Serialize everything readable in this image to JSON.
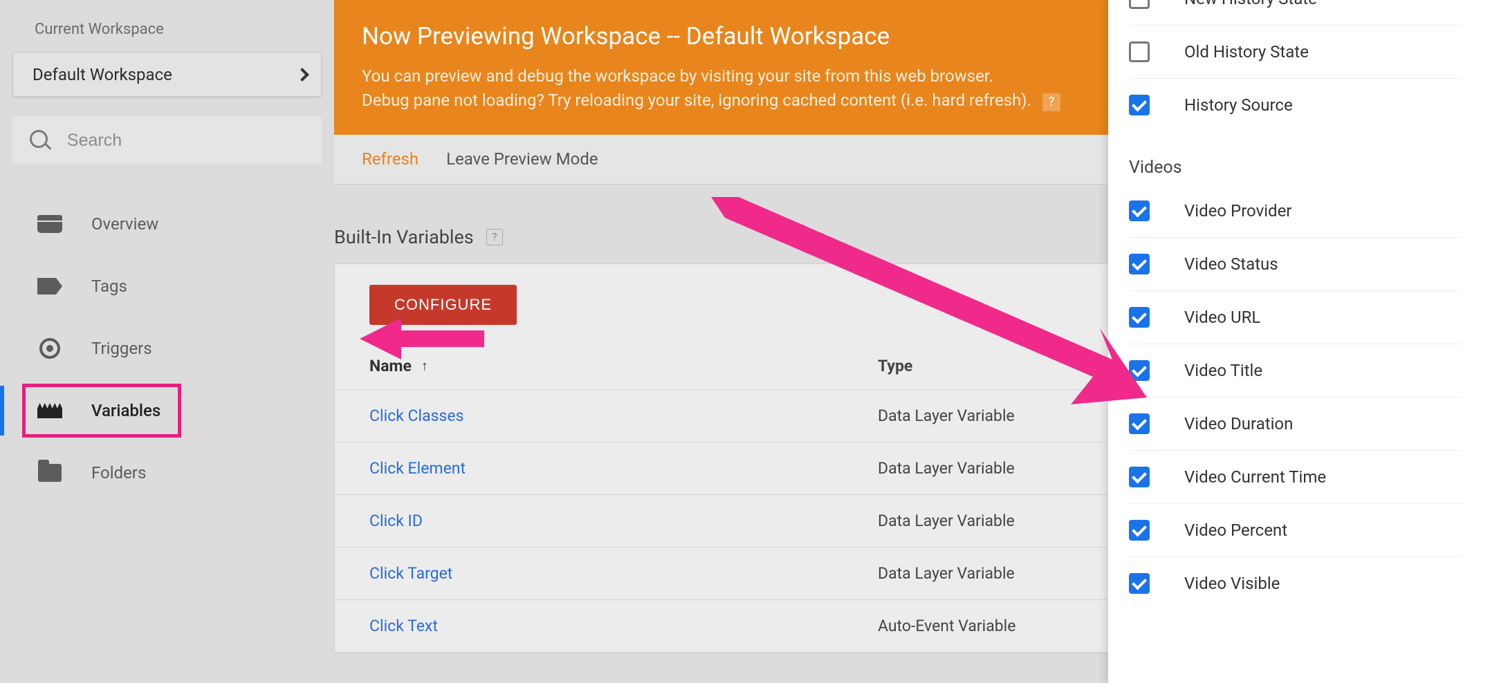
{
  "sidebar": {
    "current_workspace_label": "Current Workspace",
    "workspace_name": "Default Workspace",
    "search_placeholder": "Search",
    "items": [
      {
        "label": "Overview"
      },
      {
        "label": "Tags"
      },
      {
        "label": "Triggers"
      },
      {
        "label": "Variables"
      },
      {
        "label": "Folders"
      }
    ],
    "active_index": 3
  },
  "preview": {
    "title": "Now Previewing Workspace -- Default Workspace",
    "desc_line1": "You can preview and debug the workspace by visiting your site from this web browser.",
    "desc_line2": "Debug pane not loading? Try reloading your site, ignoring cached content (i.e. hard refresh).",
    "help": "?",
    "refresh": "Refresh",
    "leave": "Leave Preview Mode"
  },
  "builtin": {
    "heading": "Built-In Variables",
    "help": "?",
    "configure": "CONFIGURE",
    "col_name": "Name",
    "col_type": "Type",
    "rows": [
      {
        "name": "Click Classes",
        "type": "Data Layer Variable"
      },
      {
        "name": "Click Element",
        "type": "Data Layer Variable"
      },
      {
        "name": "Click ID",
        "type": "Data Layer Variable"
      },
      {
        "name": "Click Target",
        "type": "Data Layer Variable"
      },
      {
        "name": "Click Text",
        "type": "Auto-Event Variable"
      }
    ]
  },
  "panel": {
    "history": {
      "items": [
        {
          "label": "Old History State",
          "checked": false
        },
        {
          "label": "History Source",
          "checked": true
        }
      ]
    },
    "videos_heading": "Videos",
    "videos": {
      "items": [
        {
          "label": "Video Provider",
          "checked": true
        },
        {
          "label": "Video Status",
          "checked": true
        },
        {
          "label": "Video URL",
          "checked": true
        },
        {
          "label": "Video Title",
          "checked": true
        },
        {
          "label": "Video Duration",
          "checked": true
        },
        {
          "label": "Video Current Time",
          "checked": true
        },
        {
          "label": "Video Percent",
          "checked": true
        },
        {
          "label": "Video Visible",
          "checked": true
        }
      ]
    }
  }
}
